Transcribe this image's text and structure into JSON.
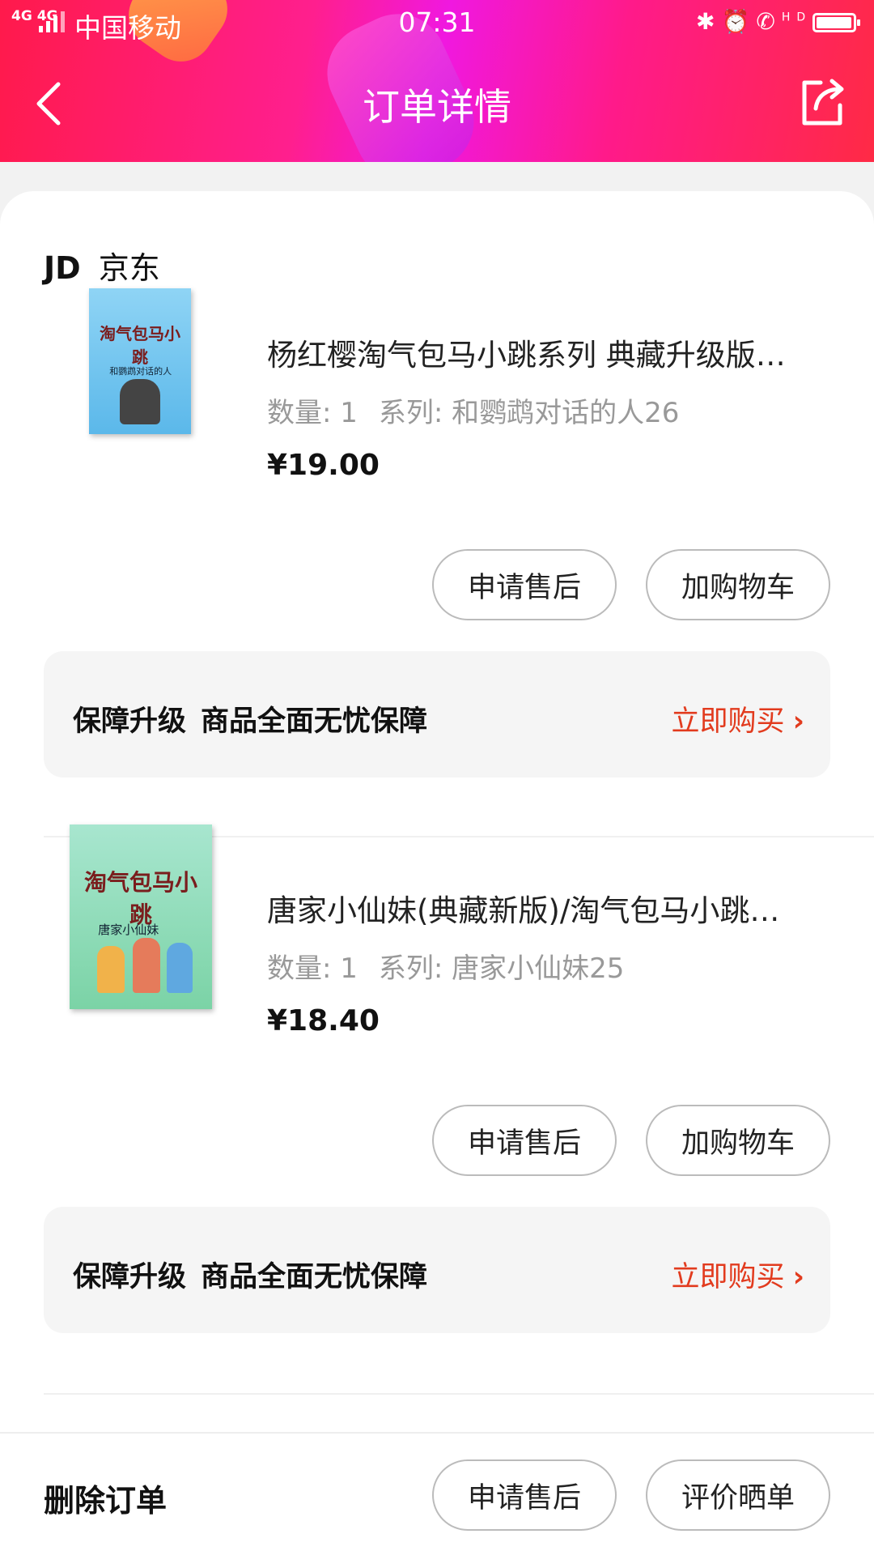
{
  "status_bar": {
    "signal": "4G 4G",
    "carrier": "中国移动",
    "time": "07:31",
    "icons": [
      "bluetooth-icon",
      "alarm-icon",
      "hd-call-icon",
      "battery-icon"
    ],
    "hd_label": "HD"
  },
  "header": {
    "title": "订单详情",
    "back_icon": "chevron-left-icon",
    "share_icon": "share-icon",
    "gradient": [
      "#ff1a4b",
      "#f018e0",
      "#ff2a45"
    ]
  },
  "shop": {
    "logo": "JD",
    "name": "京东"
  },
  "products": [
    {
      "name": "杨红樱淘气包马小跳系列 典藏升级版…",
      "qty_label": "数量: 1",
      "series_label": "系列: 和鹦鹉对话的人26",
      "price": "¥19.00",
      "cover_title": "淘气包马小跳",
      "cover_sub": "和鹦鹉对话的人",
      "buttons": {
        "after_sale": "申请售后",
        "add_cart": "加购物车"
      },
      "guarantee": {
        "text1": "保障升级",
        "text2": "商品全面无忧保障",
        "link": "立即购买"
      }
    },
    {
      "name": "唐家小仙妹(典藏新版)/淘气包马小跳…",
      "qty_label": "数量: 1",
      "series_label": "系列: 唐家小仙妹25",
      "price": "¥18.40",
      "cover_title": "淘气包马小跳",
      "cover_sub": "唐家小仙妹",
      "buttons": {
        "after_sale": "申请售后",
        "add_cart": "加购物车"
      },
      "guarantee": {
        "text1": "保障升级",
        "text2": "商品全面无忧保障",
        "link": "立即购买"
      }
    }
  ],
  "bottom_bar": {
    "delete": "删除订单",
    "after_sale": "申请售后",
    "review": "评价晒单"
  },
  "colors": {
    "accent": "#e23b1e",
    "pill_border": "#bbbbbb",
    "guarantee_bg": "#f5f5f5"
  }
}
